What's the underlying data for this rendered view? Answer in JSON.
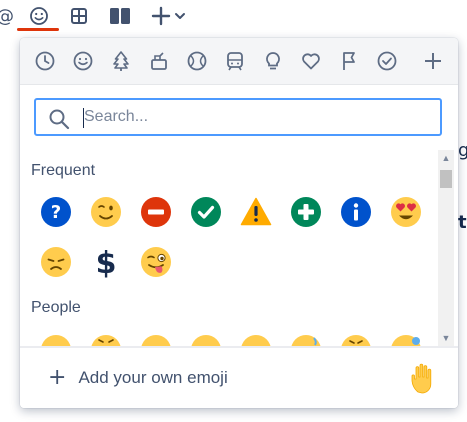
{
  "toolbar": {
    "mention_symbol": "@",
    "insert_symbol": "+",
    "icons": [
      "mention-icon",
      "emoji-icon",
      "table-icon",
      "layout-columns-icon",
      "insert-plus-icon",
      "chevron-down-icon"
    ],
    "active_underline_color": "#de350b"
  },
  "background_fragments": {
    "right_g": "g",
    "right_t": "t"
  },
  "emoji_picker": {
    "categories": [
      "recent-clock-icon",
      "people-smiley-icon",
      "nature-tree-icon",
      "food-icon",
      "activity-ball-icon",
      "travel-train-icon",
      "objects-bulb-icon",
      "symbols-heart-icon",
      "flags-icon",
      "productivity-check-icon",
      "add-category-plus-icon"
    ],
    "search": {
      "placeholder": "Search...",
      "value": ""
    },
    "sections": [
      {
        "title": "Frequent",
        "emoji_icons": [
          "question-circle-icon",
          "winking-face-icon",
          "minus-circle-icon",
          "check-circle-icon",
          "warning-triangle-icon",
          "plus-circle-icon",
          "info-circle-icon",
          "heart-eyes-face-icon",
          "disappointed-face-icon",
          "dollar-sign-icon",
          "tongue-wink-face-icon"
        ]
      },
      {
        "title": "People"
      }
    ],
    "footer": {
      "add_label": "Add your own emoji",
      "tone_icon": "raised-hand-icon"
    }
  },
  "colors": {
    "accent": "#4c9aff",
    "blue": "#0052cc",
    "green": "#00875a",
    "red": "#de350b",
    "yellow": "#ffab00",
    "face": "#ffcc4d"
  }
}
